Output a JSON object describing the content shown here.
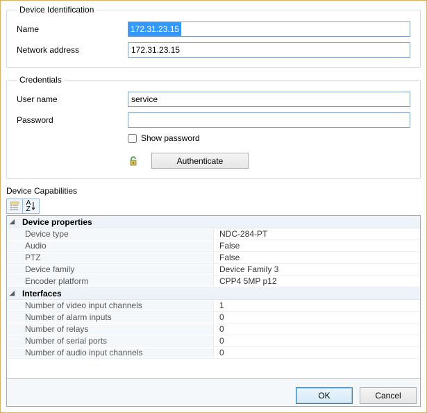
{
  "identification": {
    "legend": "Device Identification",
    "name_label": "Name",
    "name_value": "172.31.23.15",
    "netaddr_label": "Network address",
    "netaddr_value": "172.31.23.15"
  },
  "credentials": {
    "legend": "Credentials",
    "user_label": "User name",
    "user_value": "service",
    "pass_label": "Password",
    "pass_value": "",
    "show_label": "Show password",
    "auth_label": "Authenticate"
  },
  "capabilities": {
    "title": "Device Capabilities",
    "cat_props": "Device properties",
    "cat_ifaces": "Interfaces",
    "rows_props": [
      {
        "name": "Device type",
        "value": "NDC-284-PT"
      },
      {
        "name": "Audio",
        "value": "False"
      },
      {
        "name": "PTZ",
        "value": "False"
      },
      {
        "name": "Device family",
        "value": "Device Family 3"
      },
      {
        "name": "Encoder platform",
        "value": "CPP4 5MP p12"
      }
    ],
    "rows_ifaces": [
      {
        "name": "Number of video input channels",
        "value": "1"
      },
      {
        "name": "Number of alarm inputs",
        "value": "0"
      },
      {
        "name": "Number of relays",
        "value": "0"
      },
      {
        "name": "Number of serial ports",
        "value": "0"
      },
      {
        "name": "Number of audio input channels",
        "value": "0"
      }
    ]
  },
  "buttons": {
    "ok": "OK",
    "cancel": "Cancel"
  },
  "sort_label": "A\nZ"
}
